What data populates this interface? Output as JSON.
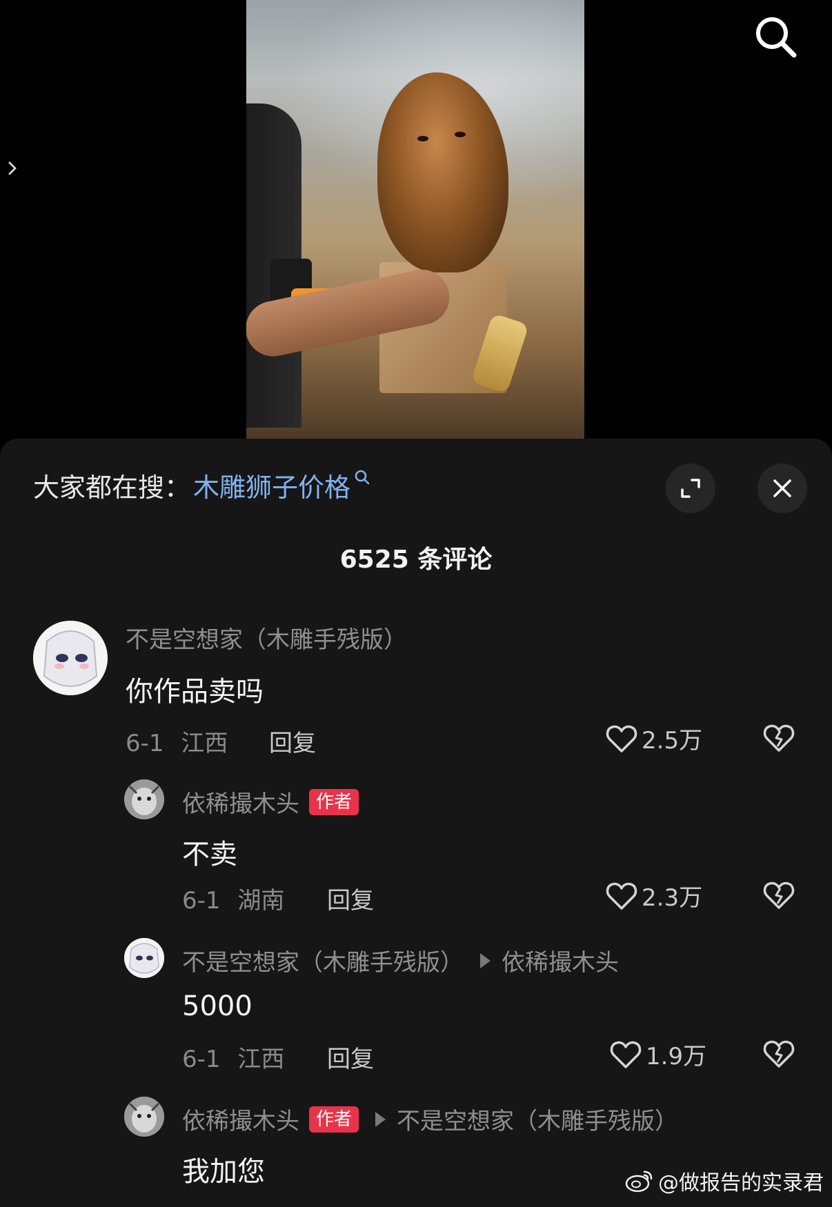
{
  "suggestion": {
    "prefix": "大家都在搜：",
    "query": "木雕狮子价格"
  },
  "comment_count": "6525 条评论",
  "comments": [
    {
      "user": "不是空想家（木雕手残版）",
      "text": "你作品卖吗",
      "date": "6-1",
      "location": "江西",
      "reply_label": "回复",
      "likes": "2.5万"
    },
    {
      "user": "依稀撮木头",
      "author_tag": "作者",
      "text": "不卖",
      "date": "6-1",
      "location": "湖南",
      "reply_label": "回复",
      "likes": "2.3万"
    },
    {
      "user": "不是空想家（木雕手残版）",
      "reply_to": "依稀撮木头",
      "text": "5000",
      "date": "6-1",
      "location": "江西",
      "reply_label": "回复",
      "likes": "1.9万"
    },
    {
      "user": "依稀撮木头",
      "author_tag": "作者",
      "reply_to": "不是空想家（木雕手残版）",
      "text": "我加您"
    }
  ],
  "watermark": "@做报告的实录君",
  "colors": {
    "sheet_bg": "#161616",
    "query_link": "#7fb2ef",
    "author_tag_bg": "#e8344a"
  },
  "icons": [
    "search-icon",
    "chevron-right-icon",
    "expand-icon",
    "close-icon",
    "heart-icon",
    "broken-heart-icon",
    "weibo-icon"
  ]
}
